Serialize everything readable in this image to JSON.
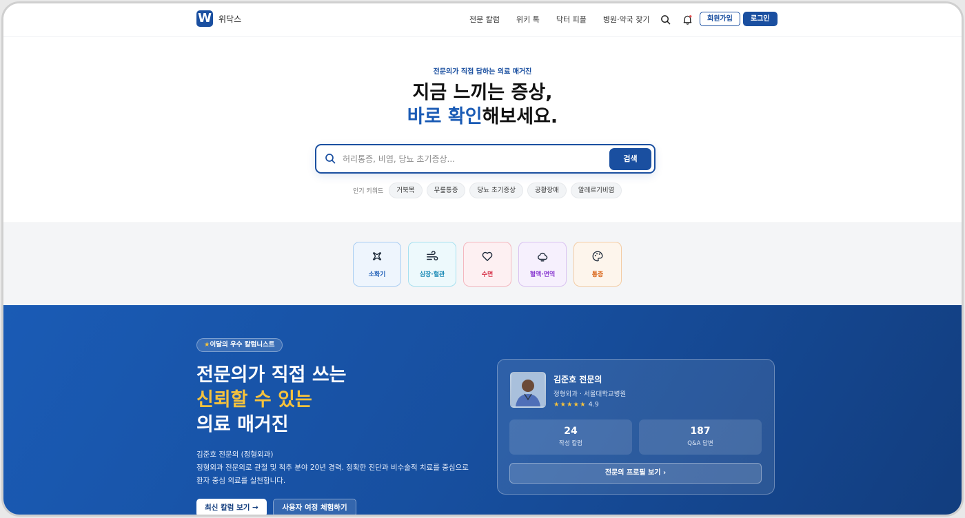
{
  "header": {
    "brand": "위닥스",
    "logo_letter": "W",
    "nav": [
      "전문 칼럼",
      "위키 톡",
      "닥터 피플",
      "병원·약국 찾기"
    ],
    "signup": "회원가입",
    "login": "로그인"
  },
  "hero": {
    "kicker": "전문의가 직접 답하는 의료 매거진",
    "title_line1": "지금 느끼는 증상,",
    "title_accent": "바로 확인",
    "title_rest": "해보세요.",
    "search_placeholder": "허리통증, 비염, 당뇨 초기증상...",
    "search_button": "검색",
    "keywords_label": "인기 키워드",
    "keywords": [
      "거북목",
      "무릎통증",
      "당뇨 초기증상",
      "공황장애",
      "알레르기비염"
    ]
  },
  "categories": [
    {
      "label": "소화기",
      "icon": "stomach-icon",
      "color": "#1a5bb5",
      "border": "#a9cdf2",
      "bg": "#eef5fd"
    },
    {
      "label": "심장·혈관",
      "icon": "wind-icon",
      "color": "#1a8ab5",
      "border": "#a6e0ef",
      "bg": "#edf9fc"
    },
    {
      "label": "수면",
      "icon": "heart-icon",
      "color": "#d6344a",
      "border": "#f4b7bf",
      "bg": "#fdf0f2"
    },
    {
      "label": "혈액·면역",
      "icon": "cloud-icon",
      "color": "#8a3bd1",
      "border": "#d9c2f1",
      "bg": "#f6f0fd"
    },
    {
      "label": "통증",
      "icon": "palette-icon",
      "color": "#d9661a",
      "border": "#f3cca4",
      "bg": "#fdf5ec"
    }
  ],
  "feature": {
    "badge_star": "★",
    "badge": "이달의 우수 칼럼니스트",
    "heading1": "전문의가 직접 쓰는",
    "heading2": "신뢰할 수 있는",
    "heading3": "의료 매거진",
    "desc1": "김준호 전문의 (정형외과)",
    "desc2": "정형외과 전문의로 관절 및 척추 분야 20년 경력. 정확한 진단과 비수술적 치료를 중심으로",
    "desc3": "환자 중심 의료를 실천합니다.",
    "btn_primary": "최신 칼럼 보기 →",
    "btn_secondary": "사용자 여정 체험하기"
  },
  "doctor_card": {
    "name": "김준호 전문의",
    "dept": "정형외과 · 서울대학교병원",
    "stars": "★★★★★",
    "rating": "4.9",
    "stat1_value": "24",
    "stat1_label": "작성 칼럼",
    "stat2_value": "187",
    "stat2_label": "Q&A 답변",
    "profile_button": "전문의 프로필 보기 ›"
  }
}
